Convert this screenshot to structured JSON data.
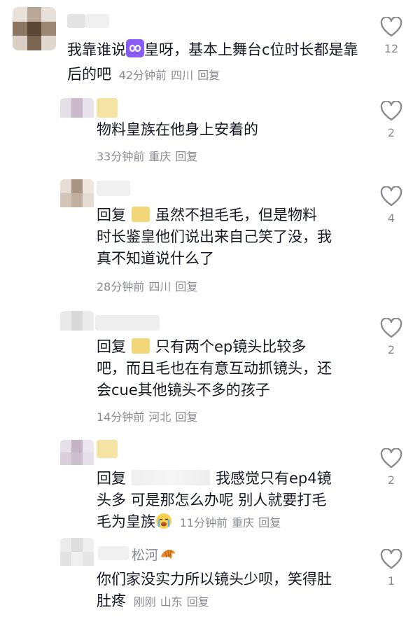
{
  "comments": [
    {
      "text_before": "我靠谁说",
      "text_after": "皇呀，基本上舞台c位时长都是靠后的吧",
      "time": "42分钟前",
      "location": "四川",
      "reply_label": "回复",
      "likes": "12"
    },
    {
      "text": "物料皇族在他身上安着的",
      "time": "33分钟前",
      "location": "重庆",
      "reply_label": "回复",
      "likes": "2"
    },
    {
      "prefix": "回复",
      "text_line1": "虽然不担毛毛，但是物料",
      "text_line2": "时长鉴皇他们说出来自己笑了没，我",
      "text_line3": "真不知道说什么了",
      "time": "28分钟前",
      "location": "四川",
      "reply_label": "回复",
      "likes": "4"
    },
    {
      "prefix": "回复",
      "text_line1": "只有两个ep镜头比较多",
      "text_line2": "吧，而且毛也在有意互动抓镜头，还",
      "text_line3": "会cue其他镜头不多的孩子",
      "time": "14分钟前",
      "location": "河北",
      "reply_label": "回复",
      "likes": "2"
    },
    {
      "prefix": "回复",
      "text_line1": "我感觉只有ep4镜",
      "text_line2": "头多 可是那怎么办呢 别人就要打毛",
      "text_line3": "毛为皇族",
      "time": "11分钟前",
      "location": "重庆",
      "reply_label": "回复",
      "likes": "2"
    },
    {
      "username": "松河",
      "text_line1": "你们家没实力所以镜头少呗，笑得肚",
      "text_line2": "肚疼",
      "time": "刚刚",
      "location": "山东",
      "reply_label": "回复",
      "likes": "1"
    }
  ],
  "icons": {
    "like": "heart-outline-icon",
    "infinity": "infinity-emoji-icon",
    "crying": "crying-emoji-icon",
    "croissant": "croissant-emoji-icon"
  },
  "colors": {
    "text": "#161823",
    "meta": "#8a8b91",
    "infinity_bg": "#8a5cf6",
    "mention_yellow": "#f2d67a"
  }
}
